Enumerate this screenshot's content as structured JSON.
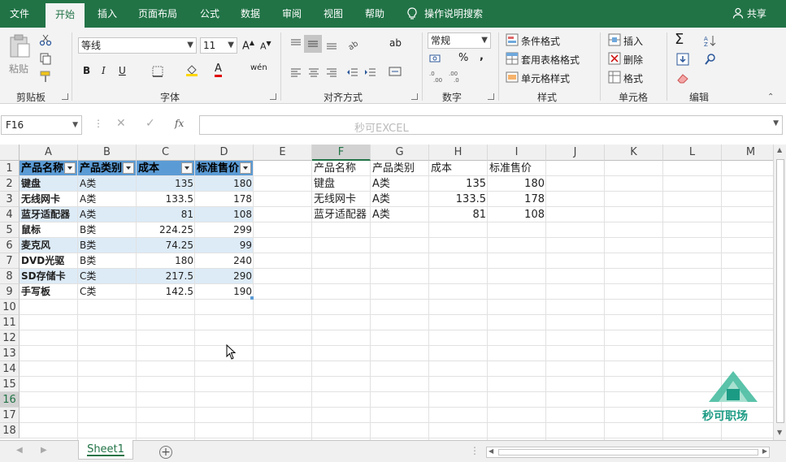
{
  "ribbon_tabs": [
    "文件",
    "开始",
    "插入",
    "页面布局",
    "公式",
    "数据",
    "审阅",
    "视图",
    "帮助"
  ],
  "tell_me": "操作说明搜索",
  "share": "共享",
  "clipboard": {
    "paste": "粘贴",
    "label": "剪贴板"
  },
  "font": {
    "name": "等线",
    "size": "11",
    "label": "字体",
    "bold": "B",
    "italic": "I",
    "underline": "U",
    "wen": "wén",
    "A": "A"
  },
  "alignment": {
    "label": "对齐方式",
    "wrap": "ab"
  },
  "number": {
    "format": "常规",
    "label": "数字",
    "percent": "%",
    "comma": ","
  },
  "styles": {
    "cond": "条件格式",
    "table": "套用表格格式",
    "cell": "单元格样式",
    "label": "样式"
  },
  "cells": {
    "insert": "插入",
    "delete": "删除",
    "format": "格式",
    "label": "单元格"
  },
  "editing": {
    "label": "编辑"
  },
  "name_box": "F16",
  "formula_placeholder": "秒可EXCEL",
  "fx": "fx",
  "columns": [
    "A",
    "B",
    "C",
    "D",
    "E",
    "F",
    "G",
    "H",
    "I",
    "J",
    "K",
    "L",
    "M"
  ],
  "rows": [
    "1",
    "2",
    "3",
    "4",
    "5",
    "6",
    "7",
    "8",
    "9",
    "10",
    "11",
    "12",
    "13",
    "14",
    "15",
    "16",
    "17",
    "18"
  ],
  "table": {
    "headers": [
      "产品名称",
      "产品类别",
      "成本",
      "标准售价"
    ],
    "rows": [
      [
        "键盘",
        "A类",
        "135",
        "180"
      ],
      [
        "无线网卡",
        "A类",
        "133.5",
        "178"
      ],
      [
        "蓝牙适配器",
        "A类",
        "81",
        "108"
      ],
      [
        "鼠标",
        "B类",
        "224.25",
        "299"
      ],
      [
        "麦克风",
        "B类",
        "74.25",
        "99"
      ],
      [
        "DVD光驱",
        "B类",
        "180",
        "240"
      ],
      [
        "SD存储卡",
        "C类",
        "217.5",
        "290"
      ],
      [
        "手写板",
        "C类",
        "142.5",
        "190"
      ]
    ]
  },
  "result": {
    "headers": [
      "产品名称",
      "产品类别",
      "成本",
      "标准售价"
    ],
    "rows": [
      [
        "键盘",
        "A类",
        "135",
        "180"
      ],
      [
        "无线网卡",
        "A类",
        "133.5",
        "178"
      ],
      [
        "蓝牙适配器",
        "A类",
        "81",
        "108"
      ]
    ]
  },
  "sheet_tab": "Sheet1",
  "add_sheet": "+",
  "watermark": "秒可职场",
  "colors": {
    "excel_green": "#217346",
    "table_header": "#5b9bd5",
    "band": "#ddebf7"
  }
}
